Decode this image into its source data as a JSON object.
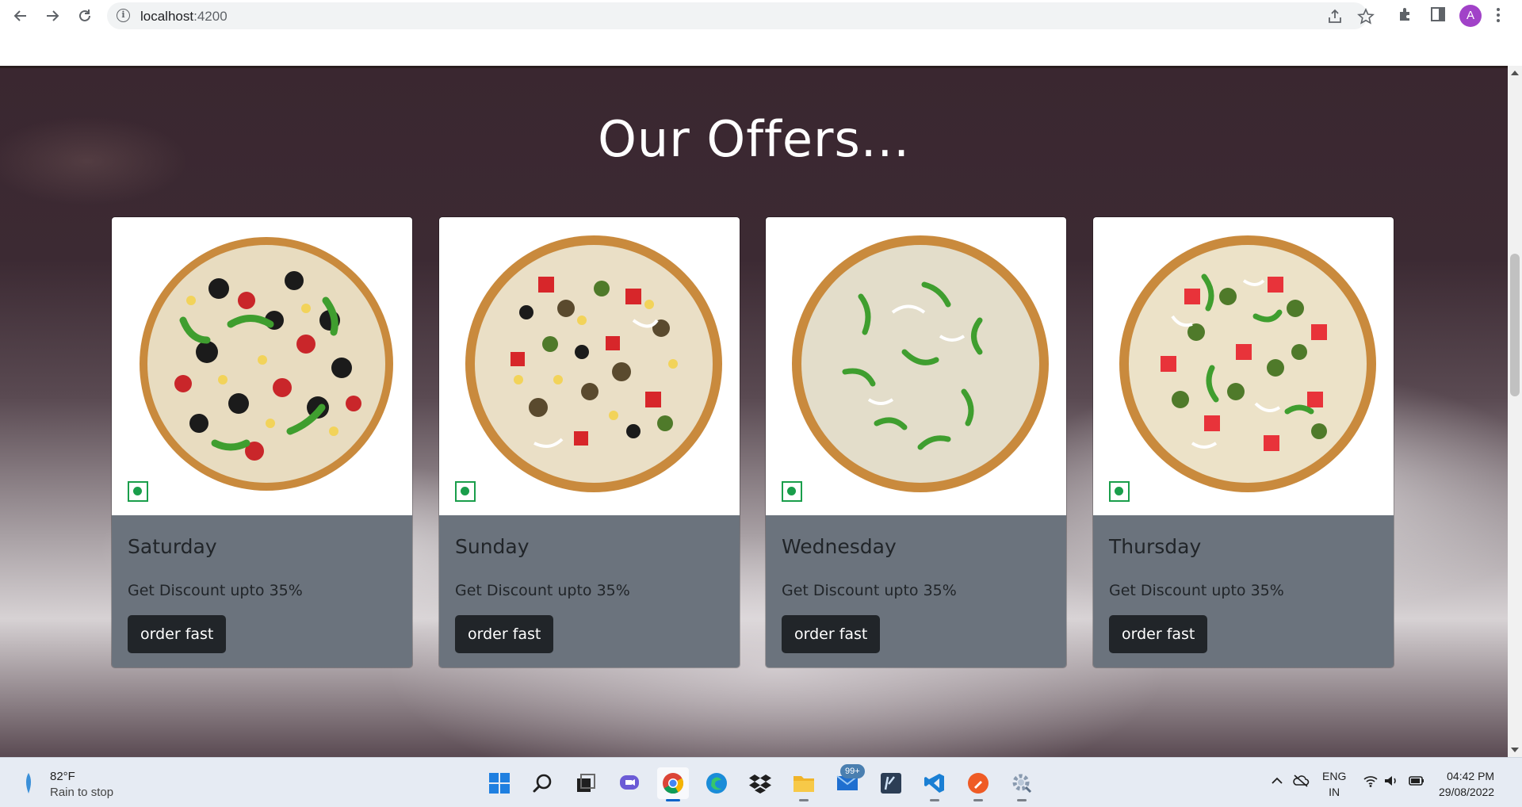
{
  "browser": {
    "url_host": "localhost",
    "url_port": ":4200",
    "profile_initial": "A",
    "icons": [
      "back-icon",
      "forward-icon",
      "reload-icon",
      "info-icon",
      "share-icon",
      "star-icon",
      "extensions-icon",
      "side-panel-icon",
      "menu-icon"
    ]
  },
  "page": {
    "heading": "Our Offers...",
    "cards": [
      {
        "title": "Saturday",
        "text": "Get Discount upto 35%",
        "button": "order fast"
      },
      {
        "title": "Sunday",
        "text": "Get Discount upto 35%",
        "button": "order fast"
      },
      {
        "title": "Wednesday",
        "text": "Get Discount upto 35%",
        "button": "order fast"
      },
      {
        "title": "Thursday",
        "text": "Get Discount upto 35%",
        "button": "order fast"
      }
    ]
  },
  "taskbar": {
    "weather_temp": "82°F",
    "weather_desc": "Rain to stop",
    "mail_badge": "99+",
    "lang_line1": "ENG",
    "lang_line2": "IN",
    "time": "04:42 PM",
    "date": "29/08/2022",
    "colors": {
      "accent": "#0a63c9",
      "veg_green": "#1a9e4b",
      "card_body": "#6b737d",
      "button": "#212529"
    }
  }
}
